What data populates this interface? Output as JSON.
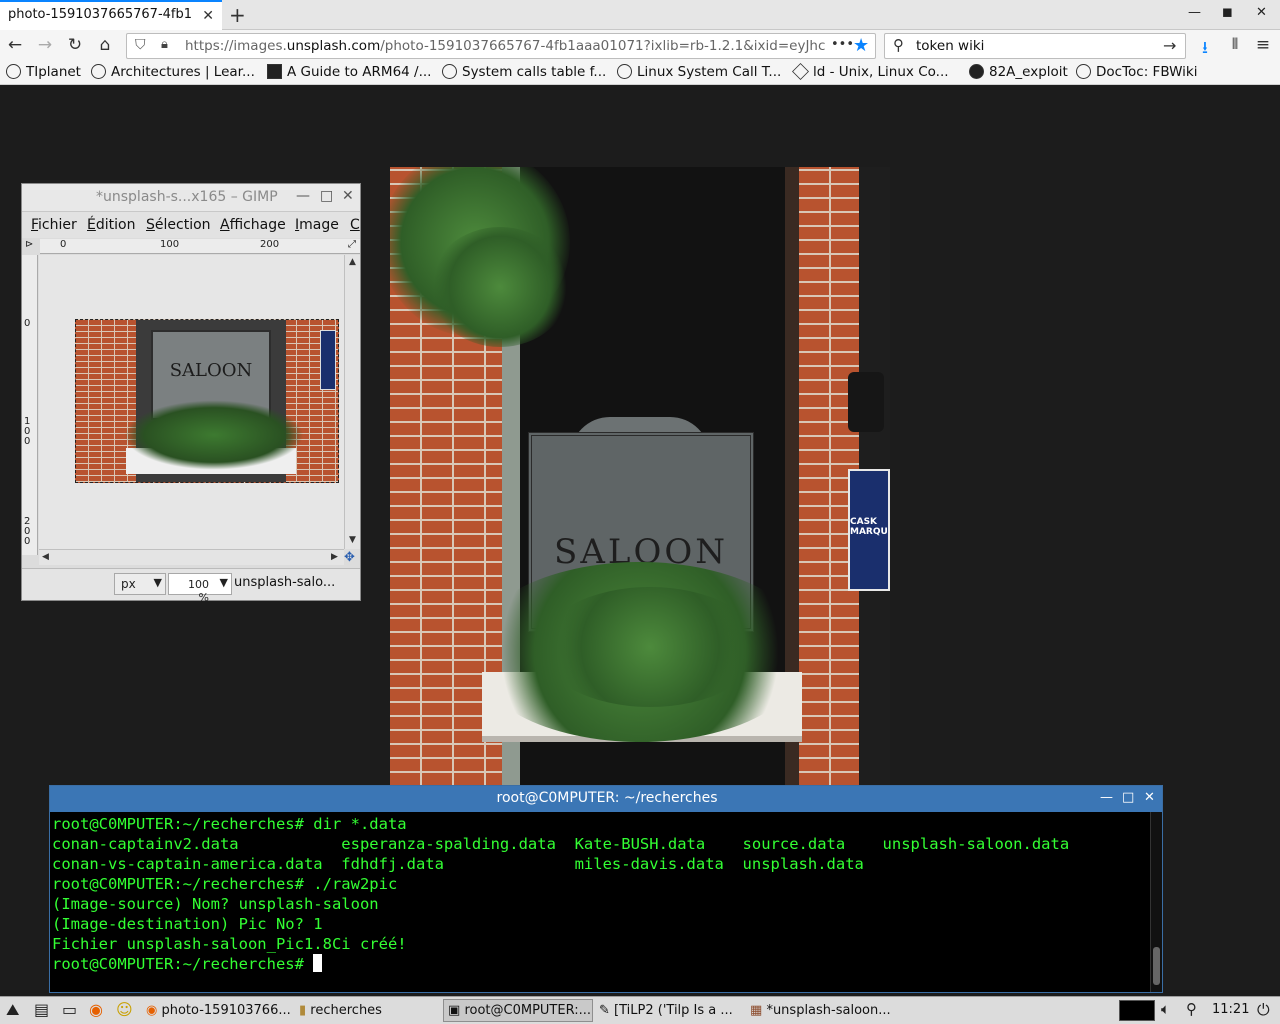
{
  "browser": {
    "tab_title": "photo-1591037665767-4fb1",
    "tab_close": "✕",
    "new_tab": "+",
    "url_prefix": "https://images.",
    "url_domain": "unsplash.com",
    "url_rest": "/photo-1591037665767-4fb1aaa01071?ixlib=rb-1.2.1&ixid=eyJhc",
    "url_more": "•••",
    "search_value": "token wiki",
    "bookmarks": [
      {
        "label": "TIplanet"
      },
      {
        "label": "Architectures | Lear..."
      },
      {
        "label": "A Guide to ARM64 /..."
      },
      {
        "label": "System calls table f..."
      },
      {
        "label": "Linux System Call T..."
      },
      {
        "label": "ld - Unix, Linux Co..."
      },
      {
        "label": "82A_exploit"
      },
      {
        "label": "DocToc: FBWiki"
      }
    ]
  },
  "photo": {
    "sign_text": "SALOON",
    "badge_text": "CASK MARQU"
  },
  "gimp": {
    "title": "*unsplash-s...x165 – GIMP",
    "menu": [
      {
        "pre": "",
        "ul": "F",
        "post": "ichier"
      },
      {
        "pre": "",
        "ul": "É",
        "post": "dition"
      },
      {
        "pre": "",
        "ul": "S",
        "post": "élection"
      },
      {
        "pre": "",
        "ul": "A",
        "post": "ffichage"
      },
      {
        "pre": "",
        "ul": "I",
        "post": "mage"
      },
      {
        "pre": "",
        "ul": "C",
        "post": ""
      }
    ],
    "ruler_h": [
      "0",
      "100",
      "200"
    ],
    "ruler_v": [
      "0",
      "1\n0\n0",
      "2\n0\n0"
    ],
    "image_text": "SALOON",
    "unit": "px",
    "zoom": "100 %",
    "image_name": "unsplash-salo..."
  },
  "terminal": {
    "title": "root@C0MPUTER: ~/recherches",
    "lines": [
      "root@C0MPUTER:~/recherches# dir *.data",
      "conan-captainv2.data           esperanza-spalding.data  Kate-BUSH.data    source.data    unsplash-saloon.data",
      "conan-vs-captain-america.data  fdhdfj.data              miles-davis.data  unsplash.data",
      "root@C0MPUTER:~/recherches# ./raw2pic",
      "(Image-source) Nom? unsplash-saloon",
      "(Image-destination) Pic No? 1",
      "Fichier unsplash-saloon_Pic1.8Ci créé!",
      "root@C0MPUTER:~/recherches# "
    ]
  },
  "taskbar": {
    "items": [
      {
        "label": "photo-159103766..."
      },
      {
        "label": "recherches"
      },
      {
        "label": "root@C0MPUTER:..."
      },
      {
        "label": "[TiLP2 ('Tilp Is a ..."
      },
      {
        "label": "*unsplash-saloon..."
      }
    ],
    "clock": "11:21"
  }
}
